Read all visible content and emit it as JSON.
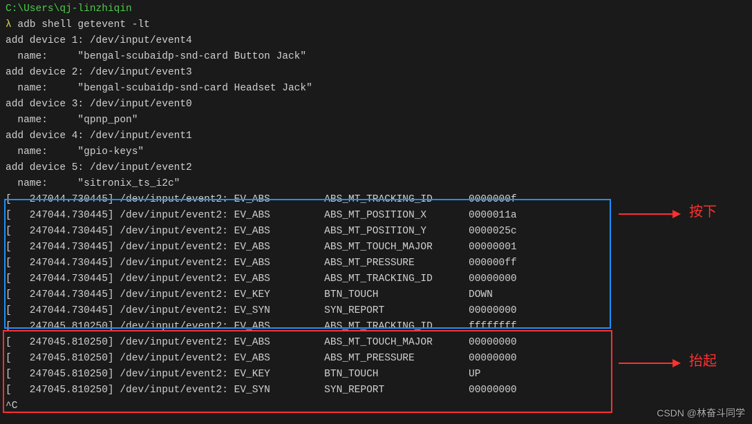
{
  "prompt_path": "C:\\Users\\qj-linzhiqin",
  "prompt_symbol": "λ",
  "command": "adb shell getevent -lt",
  "devices": [
    {
      "num": "1",
      "path": "/dev/input/event4",
      "name": "\"bengal-scubaidp-snd-card Button Jack\""
    },
    {
      "num": "2",
      "path": "/dev/input/event3",
      "name": "\"bengal-scubaidp-snd-card Headset Jack\""
    },
    {
      "num": "3",
      "path": "/dev/input/event0",
      "name": "\"qpnp_pon\""
    },
    {
      "num": "4",
      "path": "/dev/input/event1",
      "name": "\"gpio-keys\""
    },
    {
      "num": "5",
      "path": "/dev/input/event2",
      "name": "\"sitronix_ts_i2c\""
    }
  ],
  "press_events": [
    {
      "ts": "247044.730445",
      "dev": "/dev/input/event2",
      "type": "EV_ABS",
      "code": "ABS_MT_TRACKING_ID",
      "val": "0000000f"
    },
    {
      "ts": "247044.730445",
      "dev": "/dev/input/event2",
      "type": "EV_ABS",
      "code": "ABS_MT_POSITION_X",
      "val": "0000011a"
    },
    {
      "ts": "247044.730445",
      "dev": "/dev/input/event2",
      "type": "EV_ABS",
      "code": "ABS_MT_POSITION_Y",
      "val": "0000025c"
    },
    {
      "ts": "247044.730445",
      "dev": "/dev/input/event2",
      "type": "EV_ABS",
      "code": "ABS_MT_TOUCH_MAJOR",
      "val": "00000001"
    },
    {
      "ts": "247044.730445",
      "dev": "/dev/input/event2",
      "type": "EV_ABS",
      "code": "ABS_MT_PRESSURE",
      "val": "000000ff"
    },
    {
      "ts": "247044.730445",
      "dev": "/dev/input/event2",
      "type": "EV_ABS",
      "code": "ABS_MT_TRACKING_ID",
      "val": "00000000"
    },
    {
      "ts": "247044.730445",
      "dev": "/dev/input/event2",
      "type": "EV_KEY",
      "code": "BTN_TOUCH",
      "val": "DOWN"
    },
    {
      "ts": "247044.730445",
      "dev": "/dev/input/event2",
      "type": "EV_SYN",
      "code": "SYN_REPORT",
      "val": "00000000"
    }
  ],
  "release_events": [
    {
      "ts": "247045.810250",
      "dev": "/dev/input/event2",
      "type": "EV_ABS",
      "code": "ABS_MT_TRACKING_ID",
      "val": "ffffffff"
    },
    {
      "ts": "247045.810250",
      "dev": "/dev/input/event2",
      "type": "EV_ABS",
      "code": "ABS_MT_TOUCH_MAJOR",
      "val": "00000000"
    },
    {
      "ts": "247045.810250",
      "dev": "/dev/input/event2",
      "type": "EV_ABS",
      "code": "ABS_MT_PRESSURE",
      "val": "00000000"
    },
    {
      "ts": "247045.810250",
      "dev": "/dev/input/event2",
      "type": "EV_KEY",
      "code": "BTN_TOUCH",
      "val": "UP"
    },
    {
      "ts": "247045.810250",
      "dev": "/dev/input/event2",
      "type": "EV_SYN",
      "code": "SYN_REPORT",
      "val": "00000000"
    }
  ],
  "annotations": {
    "press_label": "按下",
    "release_label": "抬起"
  },
  "footer_label": "^C",
  "watermark": "CSDN @林奋斗同学"
}
